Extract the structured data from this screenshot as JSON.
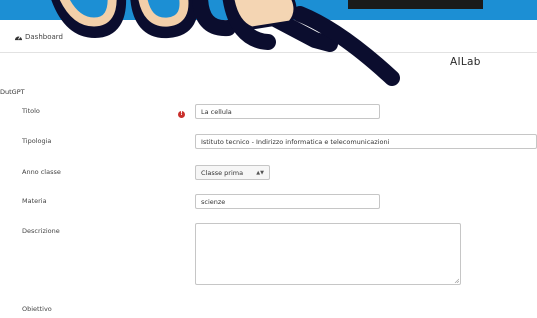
{
  "nav": {
    "dashboard_label": "Dashboard"
  },
  "brand": {
    "name": "AILab"
  },
  "section": {
    "title": "DutGPT"
  },
  "form": {
    "titolo": {
      "label": "Titolo",
      "value": "La cellula"
    },
    "tipologia": {
      "label": "Tipologia",
      "value": "Istituto tecnico - Indirizzo informatica e telecomunicazioni"
    },
    "anno_classe": {
      "label": "Anno classe",
      "value": "Classe prima",
      "caret": "▲▼"
    },
    "materia": {
      "label": "Materia",
      "value": "scienze"
    },
    "descrizione": {
      "label": "Descrizione",
      "value": ""
    },
    "obiettivo": {
      "label": "Obiettivo"
    }
  },
  "colors": {
    "accent": "#1c8fd4",
    "required": "#c9302c"
  },
  "icons": {
    "dashboard": "tachometer-icon",
    "required": "exclamation-icon",
    "resize": "resize-grip-icon"
  }
}
